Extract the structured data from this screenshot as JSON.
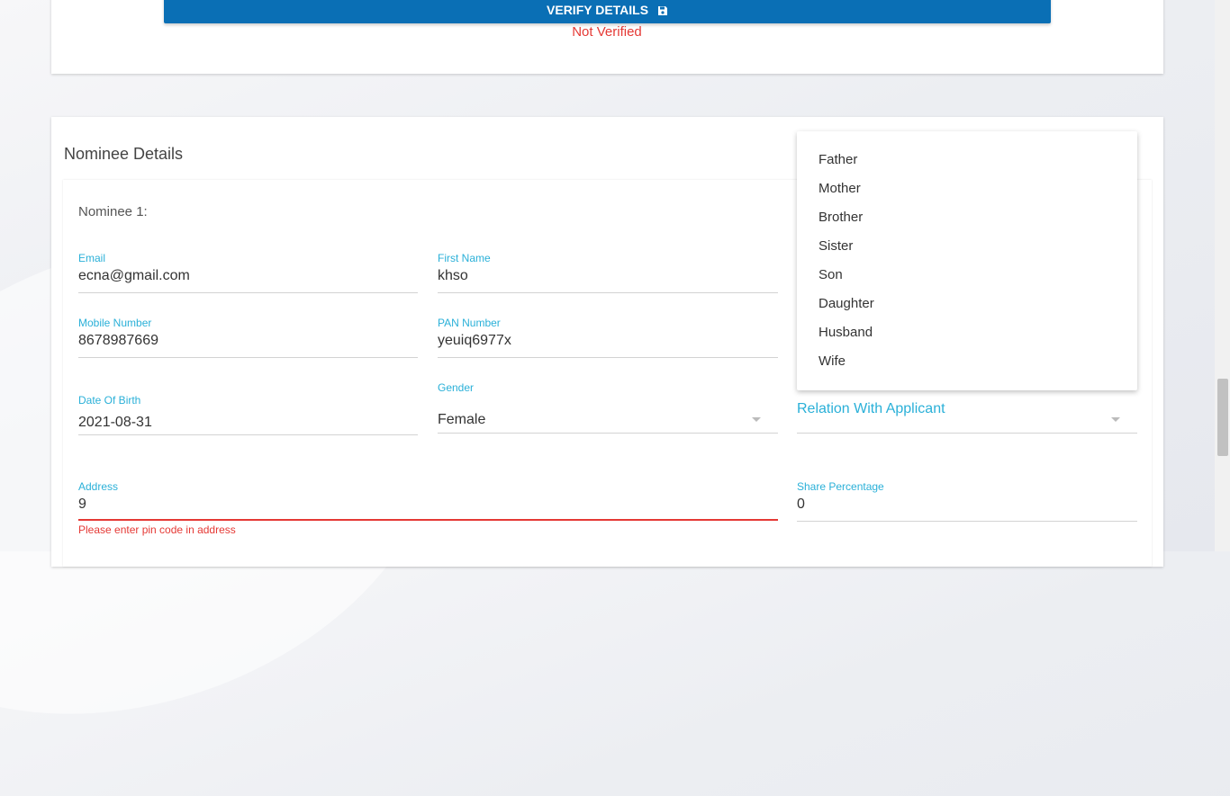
{
  "verify": {
    "button_label": "VERIFY DETAILS",
    "status": "Not Verified"
  },
  "nominee_section": {
    "title": "Nominee Details",
    "nominee_title": "Nominee 1:",
    "fields": {
      "email": {
        "label": "Email",
        "value": "ecna@gmail.com"
      },
      "first_name": {
        "label": "First Name",
        "value": "khso"
      },
      "mobile": {
        "label": "Mobile Number",
        "value": "8678987669"
      },
      "pan": {
        "label": "PAN Number",
        "value": "yeuiq6977x"
      },
      "dob": {
        "label": "Date Of Birth",
        "value": "2021-08-31"
      },
      "gender": {
        "label": "Gender",
        "value": "Female"
      },
      "relation": {
        "label": "Relation With Applicant",
        "value": ""
      },
      "address": {
        "label": "Address",
        "value": "9",
        "error": "Please enter pin code in address"
      },
      "share": {
        "label": "Share Percentage",
        "value": "0"
      }
    },
    "relation_options": [
      "Father",
      "Mother",
      "Brother",
      "Sister",
      "Son",
      "Daughter",
      "Husband",
      "Wife"
    ]
  },
  "colors": {
    "primary": "#0a6fb5",
    "label": "#2ab0d8",
    "error": "#e53935"
  },
  "icons": {
    "verify_button_icon": "save-icon"
  }
}
